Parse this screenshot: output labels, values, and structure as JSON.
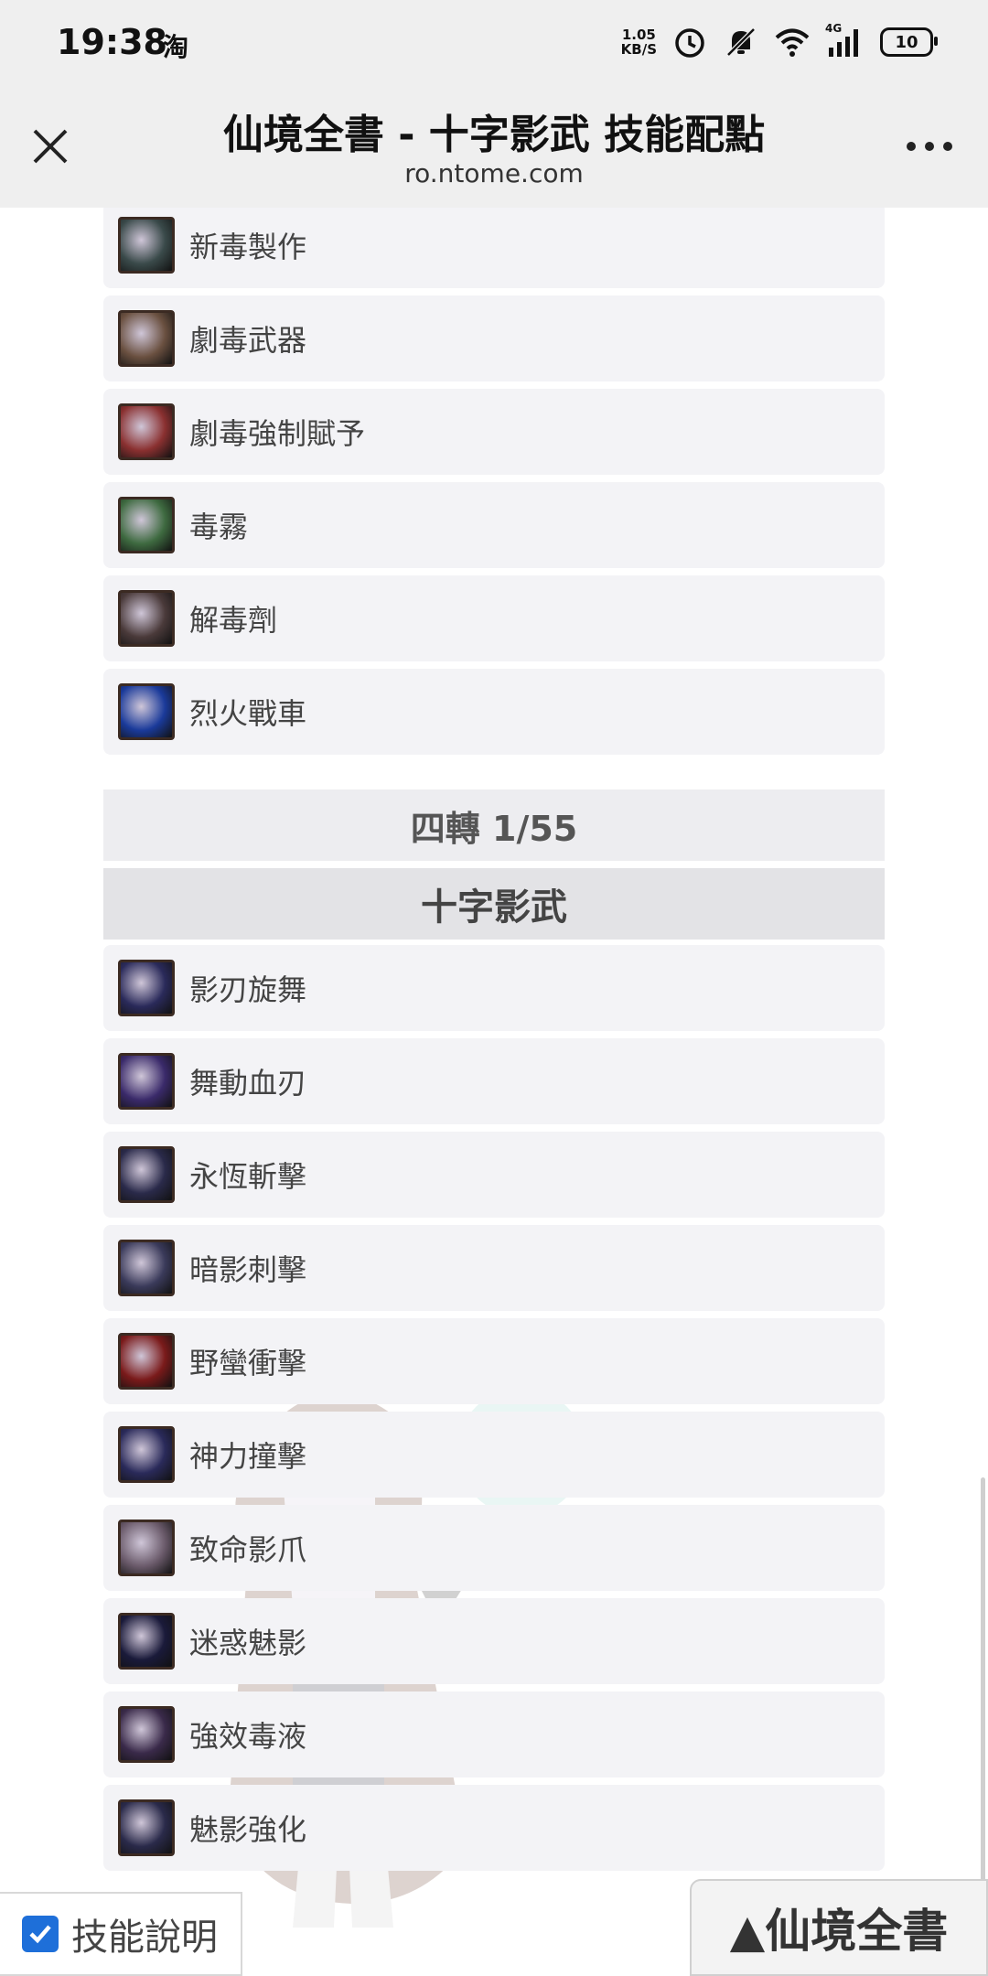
{
  "status_bar": {
    "time": "19:38",
    "app_badge": "淘",
    "net_speed_value": "1.05",
    "net_speed_unit": "KB/S",
    "signal_label": "4G",
    "battery": "10"
  },
  "title_bar": {
    "title": "仙境全書 - 十字影武 技能配點",
    "url": "ro.ntome.com"
  },
  "skills_top": [
    {
      "label": "新毒製作",
      "icon": "poison-skull-icon",
      "color": "#3a4a4a"
    },
    {
      "label": "劇毒武器",
      "icon": "poison-weapon-icon",
      "color": "#6a5040"
    },
    {
      "label": "劇毒強制賦予",
      "icon": "poison-enchant-icon",
      "color": "#8a3030"
    },
    {
      "label": "毒霧",
      "icon": "poison-mist-icon",
      "color": "#3e6a40"
    },
    {
      "label": "解毒劑",
      "icon": "antidote-icon",
      "color": "#4a3a3a"
    },
    {
      "label": "烈火戰車",
      "icon": "fire-chariot-icon",
      "color": "#1a3a9a"
    }
  ],
  "fourth_job_header": "四轉 1/55",
  "job_name": "十字影武",
  "skills_fourth": [
    {
      "label": "影刃旋舞",
      "icon": "shadow-blade-dance-icon",
      "color": "#2a2a5a"
    },
    {
      "label": "舞動血刃",
      "icon": "dancing-blood-blade-icon",
      "color": "#3a2a6a"
    },
    {
      "label": "永恆斬擊",
      "icon": "eternal-slash-icon",
      "color": "#2a2a4a"
    },
    {
      "label": "暗影刺擊",
      "icon": "shadow-stab-icon",
      "color": "#3a3a5a"
    },
    {
      "label": "野蠻衝擊",
      "icon": "savage-impact-icon",
      "color": "#7a1a1a"
    },
    {
      "label": "神力撞擊",
      "icon": "divine-strike-icon",
      "color": "#2a2a5a"
    },
    {
      "label": "致命影爪",
      "icon": "deadly-shadow-claw-icon",
      "color": "#6a5a6a"
    },
    {
      "label": "迷惑魅影",
      "icon": "bewitching-phantom-icon",
      "color": "#1a1a3a"
    },
    {
      "label": "強效毒液",
      "icon": "potent-venom-icon",
      "color": "#3a2a4a"
    },
    {
      "label": "魅影強化",
      "icon": "phantom-enhance-icon",
      "color": "#2a2a4a"
    }
  ],
  "bottom": {
    "skill_desc_label": "技能說明",
    "skill_desc_checked": true,
    "home_button": "▲仙境全書"
  },
  "colors": {
    "accent": "#1e6fd9",
    "row_bg": "#f3f3f6",
    "header_bg": "#ededf0"
  }
}
